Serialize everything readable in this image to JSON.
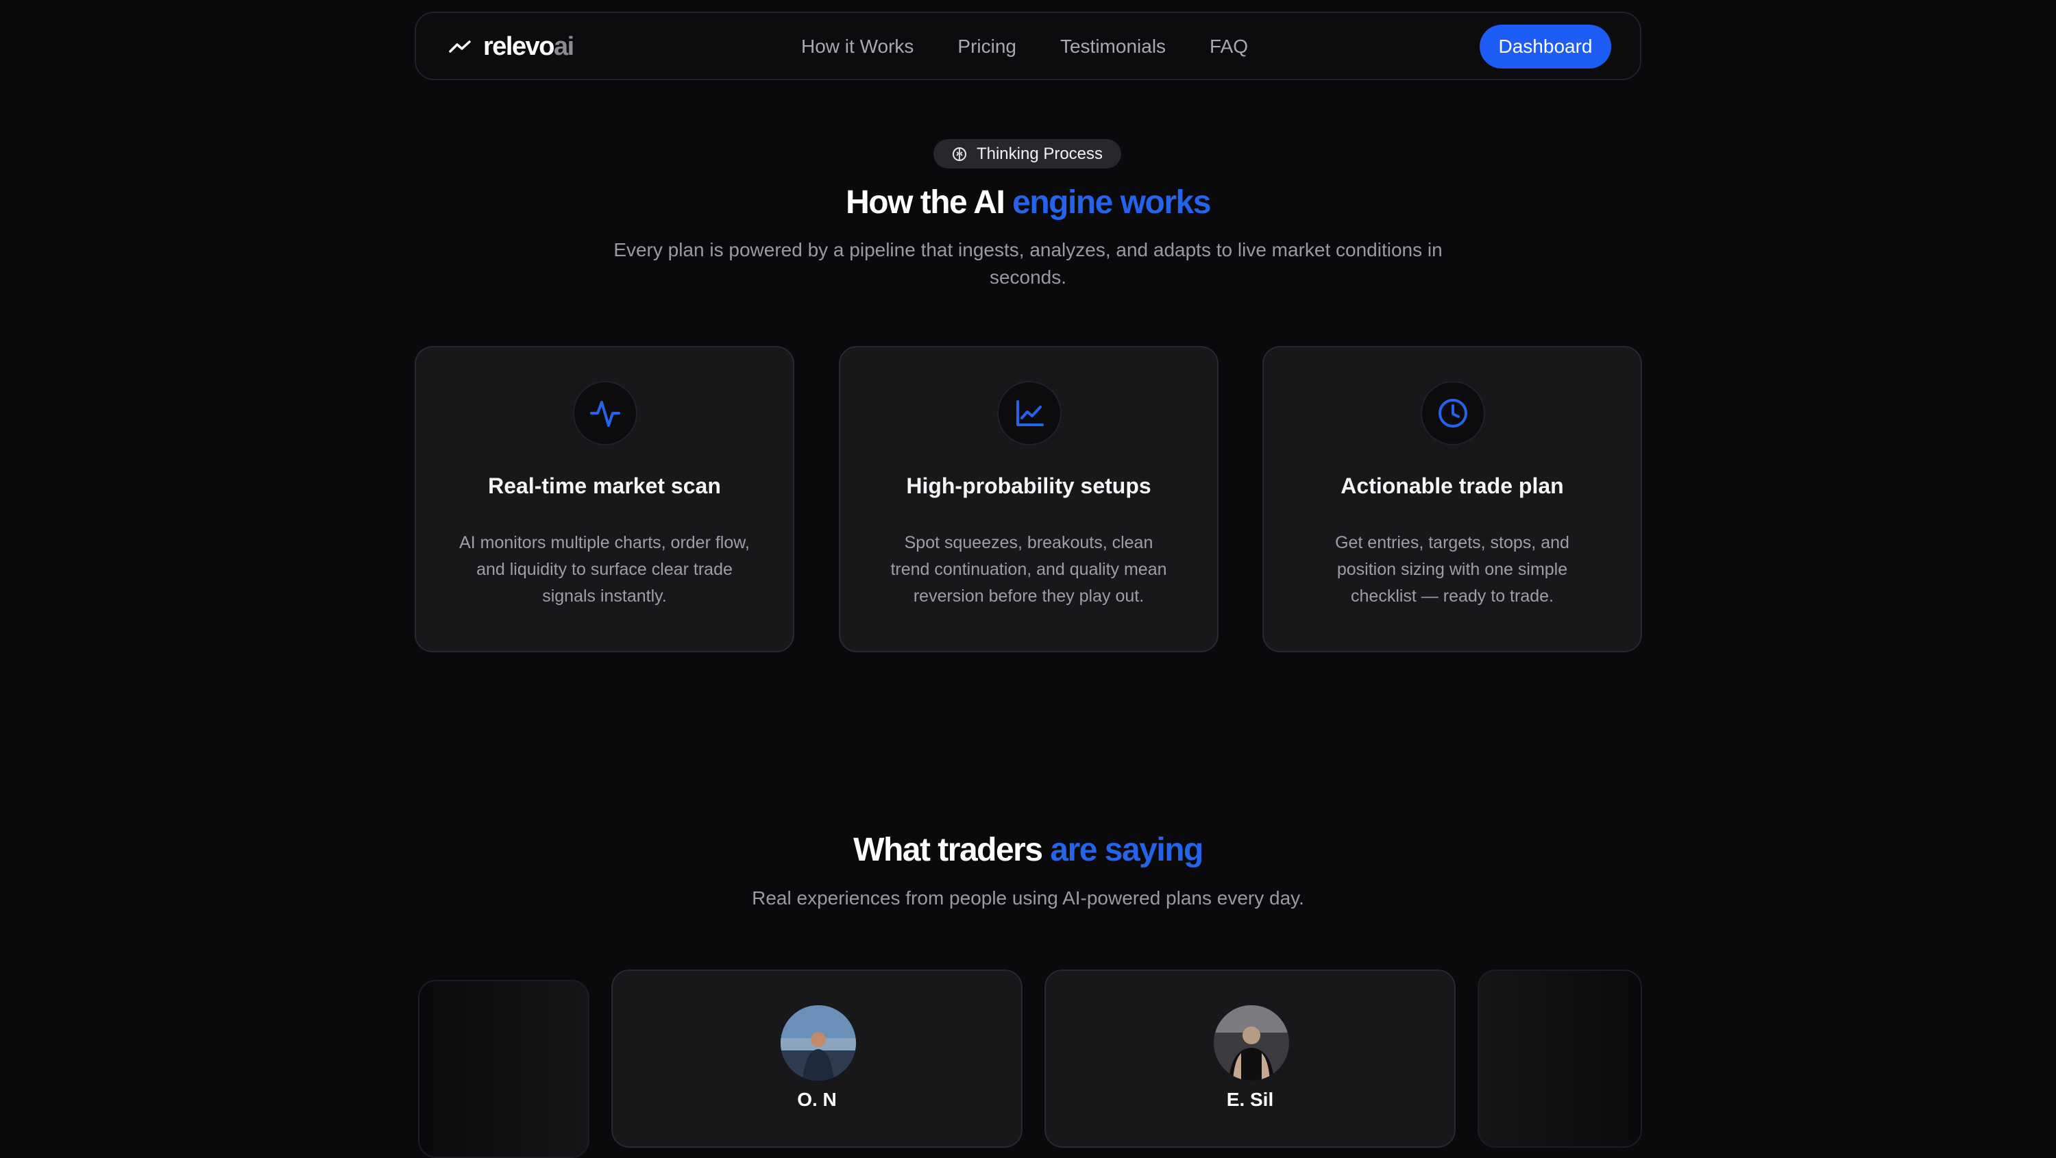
{
  "nav": {
    "logo": {
      "main": "relevo",
      "suffix": "ai",
      "icon": "trend-line-icon"
    },
    "links": [
      "How it Works",
      "Pricing",
      "Testimonials",
      "FAQ"
    ],
    "cta": "Dashboard"
  },
  "engine": {
    "badge": {
      "icon": "brain-icon",
      "label": "Thinking Process"
    },
    "title_pre": "How the AI ",
    "title_accent": "engine works",
    "subtitle_line1": "Every plan is powered by a pipeline that ingests, analyzes, and adapts to live market conditions in",
    "subtitle_line2": "seconds.",
    "cards": [
      {
        "icon": "activity-pulse-icon",
        "title": "Real-time market scan",
        "desc": "AI monitors multiple charts, order flow, and liquidity to surface clear trade signals instantly."
      },
      {
        "icon": "line-chart-icon",
        "title": "High-probability setups",
        "desc": "Spot squeezes, breakouts, clean trend continuation, and quality mean reversion before they play out."
      },
      {
        "icon": "clock-icon",
        "title": "Actionable trade plan",
        "desc": "Get entries, targets, stops, and position sizing with one simple checklist — ready to trade."
      }
    ]
  },
  "testimonials": {
    "title_pre": "What traders ",
    "title_accent": "are saying",
    "subtitle": "Real experiences from people using AI-powered plans every day.",
    "names": [
      "O. N",
      "E. Sil"
    ]
  },
  "colors": {
    "accent": "#2563eb",
    "button": "#1d5cf5",
    "background": "#0a0a0c",
    "card": "#18181b"
  }
}
